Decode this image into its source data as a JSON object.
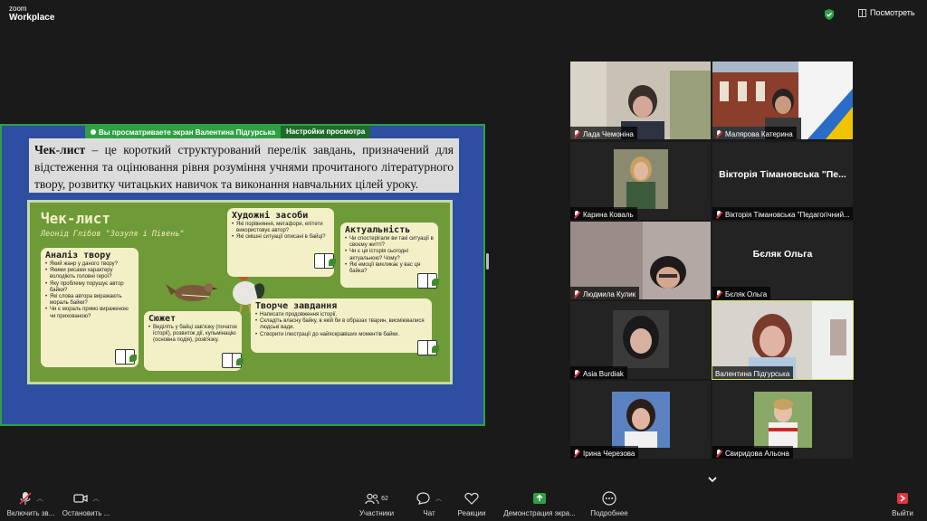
{
  "app": {
    "logo_top": "zoom",
    "logo_bottom": "Workplace",
    "view_label": "Посмотреть",
    "shield_color": "#2ea043"
  },
  "share": {
    "banner_viewing": "Вы просматриваете экран  Валентина Підгурська",
    "banner_settings": "Настройки просмотра",
    "intro_bold": "Чек-лист",
    "intro_text": " – це короткий структурований перелік завдань, призначений для відстеження та оцінювання рівня розуміння учнями прочитаного літературного твору, розвитку читацьких навичок та виконання навчальних цілей уроку.",
    "poster_title": "Чек-лист",
    "poster_subtitle": "Леонід Глібов \"Зозуля і Півень\"",
    "cards": {
      "analysis": {
        "title": "Аналіз твору",
        "items": [
          "Який жанр у даного твору?",
          "Якими рисами характеру володіють головні герої?",
          "Яку проблему порушує автор байки?",
          "Які слова автора виражають мораль байки?",
          "Чи є мораль прямо вираженою чи прихованою?"
        ]
      },
      "means": {
        "title": "Художні засоби",
        "items": [
          "Які порівняння, метафори, епітети використовує автор?",
          "Які смішні ситуації описані в байці?"
        ]
      },
      "relevance": {
        "title": "Актуальність",
        "items": [
          "Чи спостерігали ви такі ситуації в своєму житті?",
          "Чи є ця історія сьогодні актуальною? Чому?",
          "Які емоції викликає у вас ця байка?"
        ]
      },
      "plot": {
        "title": "Сюжет",
        "items": [
          "Виділіть у байці зав'язку (початок історії), розвиток дії, кульмінацію (основна подія), розв'язку."
        ]
      },
      "creative": {
        "title": "Творче завдання",
        "items": [
          "Написати продовження історії.",
          "Складіть власну байку, в якій би в образах тварин, висміювалися людські вади.",
          "Створити ілюстрації до найяскравіших моментів байки."
        ]
      }
    }
  },
  "participants": [
    {
      "name": "Лада Чемоніна",
      "muted": true
    },
    {
      "name": "Малярова Катерина",
      "muted": true
    },
    {
      "name": "Карина Коваль",
      "muted": true
    },
    {
      "name": "Вікторія Тімановська \"Педагогічний...",
      "muted": true,
      "big_name": "Вікторія Тімановська \"Пе..."
    },
    {
      "name": "Людмила Кулик",
      "muted": true
    },
    {
      "name": "Бєляк Ольга",
      "muted": true,
      "big_name": "Бєляк Ольга"
    },
    {
      "name": "Asia Burdiak",
      "muted": true
    },
    {
      "name": "Валентина Підгурська",
      "muted": false
    },
    {
      "name": "Ірина Черезова",
      "muted": true
    },
    {
      "name": "Свиридова Альона",
      "muted": true
    }
  ],
  "toolbar": {
    "mic_label": "Включить зв...",
    "video_label": "Остановить ...",
    "participants_label": "Участники",
    "participants_count": "62",
    "chat_label": "Чат",
    "reactions_label": "Реакции",
    "share_label": "Демонстрация экра...",
    "more_label": "Подробнее",
    "leave_label": "Выйти",
    "share_color": "#2ea043",
    "leave_color": "#e0333f"
  }
}
